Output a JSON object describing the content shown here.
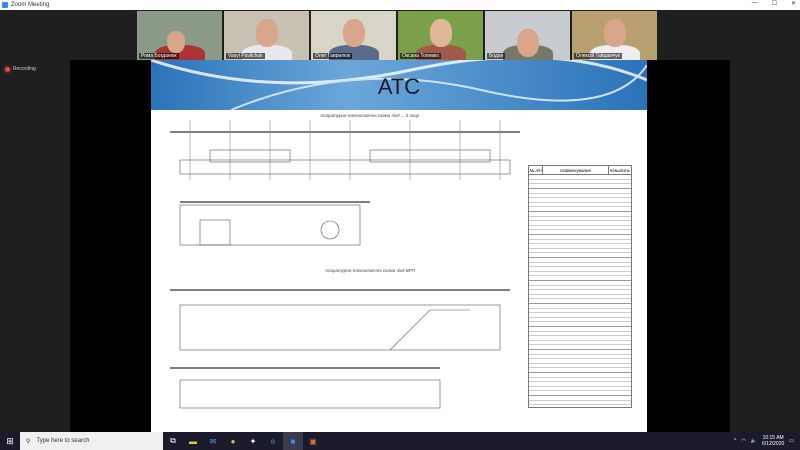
{
  "window": {
    "title": "Zoom Meeting",
    "minimize": "—",
    "maximize": "☐",
    "close": "✕"
  },
  "recording": {
    "label": "Recording",
    "color": "#e8453c"
  },
  "participants": [
    {
      "name": "Рома Богданюк"
    },
    {
      "name": "Vasyl Pavlichuk"
    },
    {
      "name": "Олег Гаврилюк"
    },
    {
      "name": "Оксана Толевко"
    },
    {
      "name": "Бодан"
    },
    {
      "name": "Олексій Гайдамчук"
    }
  ],
  "slide": {
    "title": "АТС",
    "drawing_title_1": "Апаратурно-технологічна схема лінії ... 5 акор",
    "drawing_title_2": "Апаратурно-технологічна схема лінії ВРП",
    "table_headers": [
      "№ п/п",
      "Найменування",
      "Кількість"
    ]
  },
  "taskbar": {
    "search_placeholder": "Type here to search",
    "time": "10:15 AM",
    "date": "6/12/2020"
  }
}
